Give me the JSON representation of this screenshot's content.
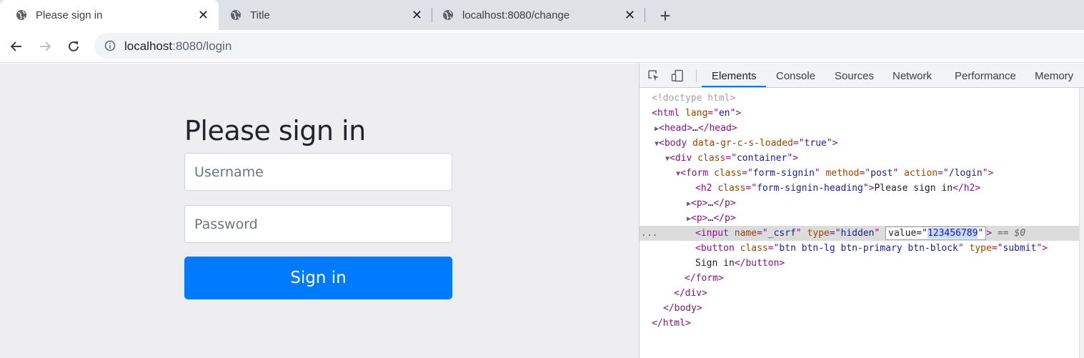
{
  "browser": {
    "tabs": [
      {
        "title": "Please sign in",
        "active": true
      },
      {
        "title": "Title",
        "active": false
      },
      {
        "title": "localhost:8080/change",
        "active": false
      }
    ],
    "new_tab_label": "+",
    "close_glyph": "✕",
    "url": {
      "host": "localhost",
      "path": ":8080/login"
    }
  },
  "page": {
    "heading": "Please sign in",
    "username_placeholder": "Username",
    "password_placeholder": "Password",
    "signin_label": "Sign in",
    "accent_color": "#007bff"
  },
  "devtools": {
    "tabs": [
      "Elements",
      "Console",
      "Sources",
      "Network",
      "Performance",
      "Memory"
    ],
    "active_tab": "Elements",
    "lines": {
      "l0": {
        "doctype": "<!doctype html>"
      },
      "l1": {
        "open": "<html ",
        "attr": "lang",
        "eq": "=\"",
        "val": "en",
        "close": "\">"
      },
      "l2": {
        "open": "<head>",
        "ell": "…",
        "close": "</head>"
      },
      "l3": {
        "open": "<body ",
        "attr": "data-gr-c-s-loaded",
        "eq": "=\"",
        "val": "true",
        "close": "\">"
      },
      "l4": {
        "open": "<div ",
        "attr": "class",
        "eq": "=\"",
        "val": "container",
        "close": "\">"
      },
      "l5": {
        "open": "<form ",
        "a1": "class",
        "v1": "form-signin",
        "a2": "method",
        "v2": "post",
        "a3": "action",
        "v3": "/login",
        "close": "\">"
      },
      "l6": {
        "open": "<h2 ",
        "attr": "class",
        "eq": "=\"",
        "val": "form-signin-heading",
        "mid": "\">",
        "text": "Please sign in",
        "close": "</h2>"
      },
      "l7": {
        "open": "<p>",
        "ell": "…",
        "close": "</p>"
      },
      "l8": {
        "open": "<p>",
        "ell": "…",
        "close": "</p>"
      },
      "l9": {
        "open": "<input ",
        "a1": "name",
        "v1": "_csrf",
        "a2": "type",
        "v2": "hidden",
        "a3": "value",
        "v3": "123456789",
        "close": "\">",
        "eq0": "== $0",
        "dots": "..."
      },
      "l10": {
        "open": "<button ",
        "a1": "class",
        "v1": "btn btn-lg btn-primary btn-block",
        "a2": "type",
        "v2": "submit",
        "close": "\">"
      },
      "l11": {
        "text": "Sign in",
        "close": "</button>"
      },
      "l12": {
        "close": "</form>"
      },
      "l13": {
        "close": "</div>"
      },
      "l14": {
        "close": "</body>"
      },
      "l15": {
        "close": "</html>"
      }
    }
  },
  "icons": [
    "globe-icon",
    "back-arrow-icon",
    "forward-arrow-icon",
    "reload-icon",
    "info-icon",
    "inspect-element-icon",
    "device-toolbar-icon",
    "expand-triangle-icon"
  ]
}
